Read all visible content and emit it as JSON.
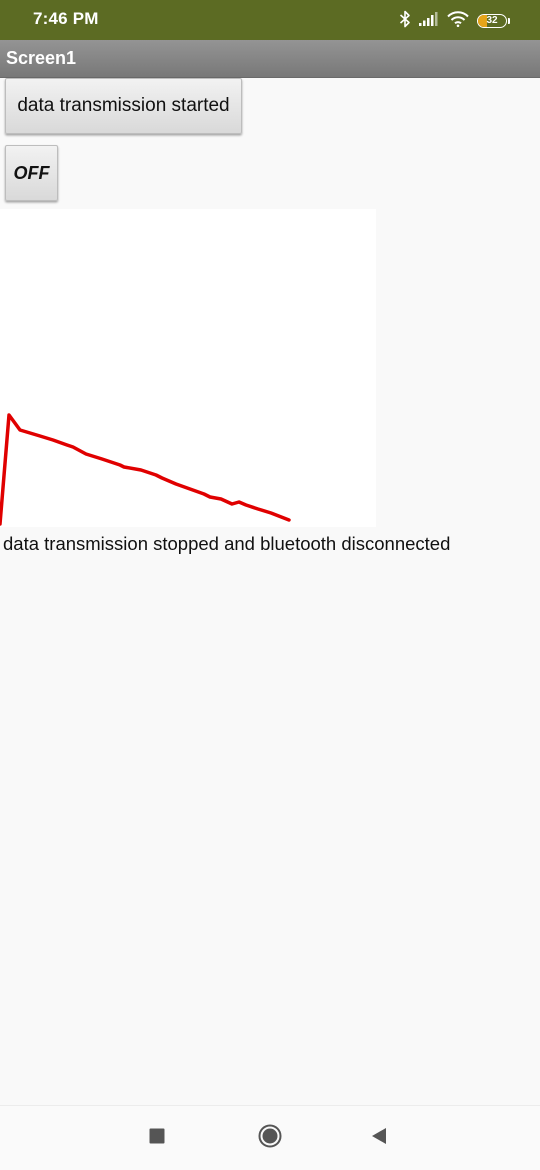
{
  "status_bar": {
    "time": "7:46 PM",
    "battery_level": "32",
    "battery_percent": 32,
    "icons": [
      "bluetooth-icon",
      "signal-icon",
      "wifi-icon",
      "battery-icon"
    ],
    "background_color": "#5c6b23"
  },
  "title_bar": {
    "title": "Screen1"
  },
  "buttons": {
    "transmission_label": "data transmission started",
    "off_label": "OFF"
  },
  "message": "data transmission stopped and bluetooth disconnected",
  "canvas": {
    "line_color": "#e00000"
  },
  "nav_bar": {
    "icons": [
      "recents-square-icon",
      "home-circle-icon",
      "back-triangle-icon"
    ]
  }
}
